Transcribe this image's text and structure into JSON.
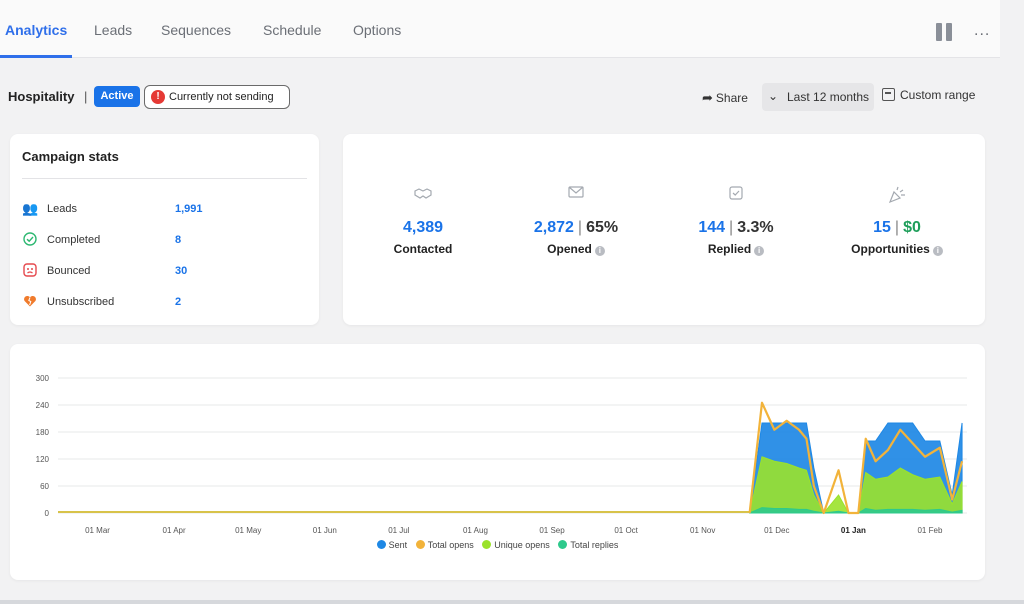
{
  "tabs": [
    {
      "label": "Analytics",
      "active": true
    },
    {
      "label": "Leads"
    },
    {
      "label": "Sequences"
    },
    {
      "label": "Schedule"
    },
    {
      "label": "Options"
    }
  ],
  "header": {
    "campaign_name": "Hospitality",
    "separator": "|",
    "status_badge": "Active",
    "sending_status": "Currently not sending",
    "share_label": "Share",
    "range_label": "Last 12 months",
    "custom_range_label": "Custom range",
    "more_label": "..."
  },
  "campaign_stats": {
    "title": "Campaign stats",
    "rows": [
      {
        "label": "Leads",
        "value": "1,991",
        "icon": "users-icon"
      },
      {
        "label": "Completed",
        "value": "8",
        "icon": "check-circle-icon"
      },
      {
        "label": "Bounced",
        "value": "30",
        "icon": "bounce-icon"
      },
      {
        "label": "Unsubscribed",
        "value": "2",
        "icon": "broken-heart-icon"
      }
    ]
  },
  "metrics": {
    "contacted": {
      "value": "4,389",
      "label": "Contacted",
      "icon": "handshake-icon"
    },
    "opened": {
      "value": "2,872",
      "sep": "|",
      "pct": "65%",
      "label": "Opened",
      "icon": "envelope-icon"
    },
    "replied": {
      "value": "144",
      "sep": "|",
      "pct": "3.3%",
      "label": "Replied",
      "icon": "reply-icon"
    },
    "opportunities": {
      "value": "15",
      "sep": "|",
      "amount": "$0",
      "label": "Opportunities",
      "icon": "party-popper-icon"
    }
  },
  "colors": {
    "accent": "#2f6fea",
    "sent": "#1e88e5",
    "total_opens": "#f2b33a",
    "unique_opens": "#9be22b",
    "total_replies": "#2ec98c"
  },
  "chart_data": {
    "type": "area",
    "title": "",
    "xlabel": "",
    "ylabel": "",
    "ylim": [
      0,
      300
    ],
    "yticks": [
      0,
      60,
      120,
      180,
      240,
      300
    ],
    "x_tick_labels": [
      "01 Mar",
      "01 Apr",
      "01 May",
      "01 Jun",
      "01 Jul",
      "01 Aug",
      "01 Sep",
      "01 Oct",
      "01 Nov",
      "01 Dec",
      "01 Jan",
      "01 Feb"
    ],
    "grid": true,
    "legend_position": "bottom",
    "x": [
      "2023-11-20",
      "2023-11-25",
      "2023-11-30",
      "2023-12-05",
      "2023-12-10",
      "2023-12-13",
      "2023-12-16",
      "2023-12-20",
      "2023-12-26",
      "2023-12-30",
      "2024-01-03",
      "2024-01-06",
      "2024-01-10",
      "2024-01-15",
      "2024-01-20",
      "2024-01-25",
      "2024-01-30",
      "2024-02-05",
      "2024-02-10",
      "2024-02-14"
    ],
    "series": [
      {
        "name": "Sent",
        "values": [
          0,
          200,
          200,
          200,
          200,
          200,
          100,
          0,
          0,
          0,
          0,
          160,
          160,
          200,
          200,
          200,
          160,
          160,
          40,
          200
        ]
      },
      {
        "name": "Total opens",
        "values": [
          0,
          245,
          185,
          205,
          185,
          165,
          60,
          0,
          95,
          0,
          0,
          165,
          115,
          140,
          185,
          155,
          125,
          145,
          30,
          115
        ]
      },
      {
        "name": "Unique opens",
        "values": [
          0,
          125,
          115,
          110,
          100,
          95,
          40,
          0,
          40,
          0,
          0,
          90,
          75,
          80,
          100,
          85,
          75,
          80,
          20,
          70
        ]
      },
      {
        "name": "Total replies",
        "values": [
          0,
          12,
          10,
          10,
          8,
          8,
          4,
          0,
          4,
          0,
          0,
          10,
          6,
          8,
          8,
          8,
          6,
          8,
          2,
          6
        ]
      }
    ]
  }
}
